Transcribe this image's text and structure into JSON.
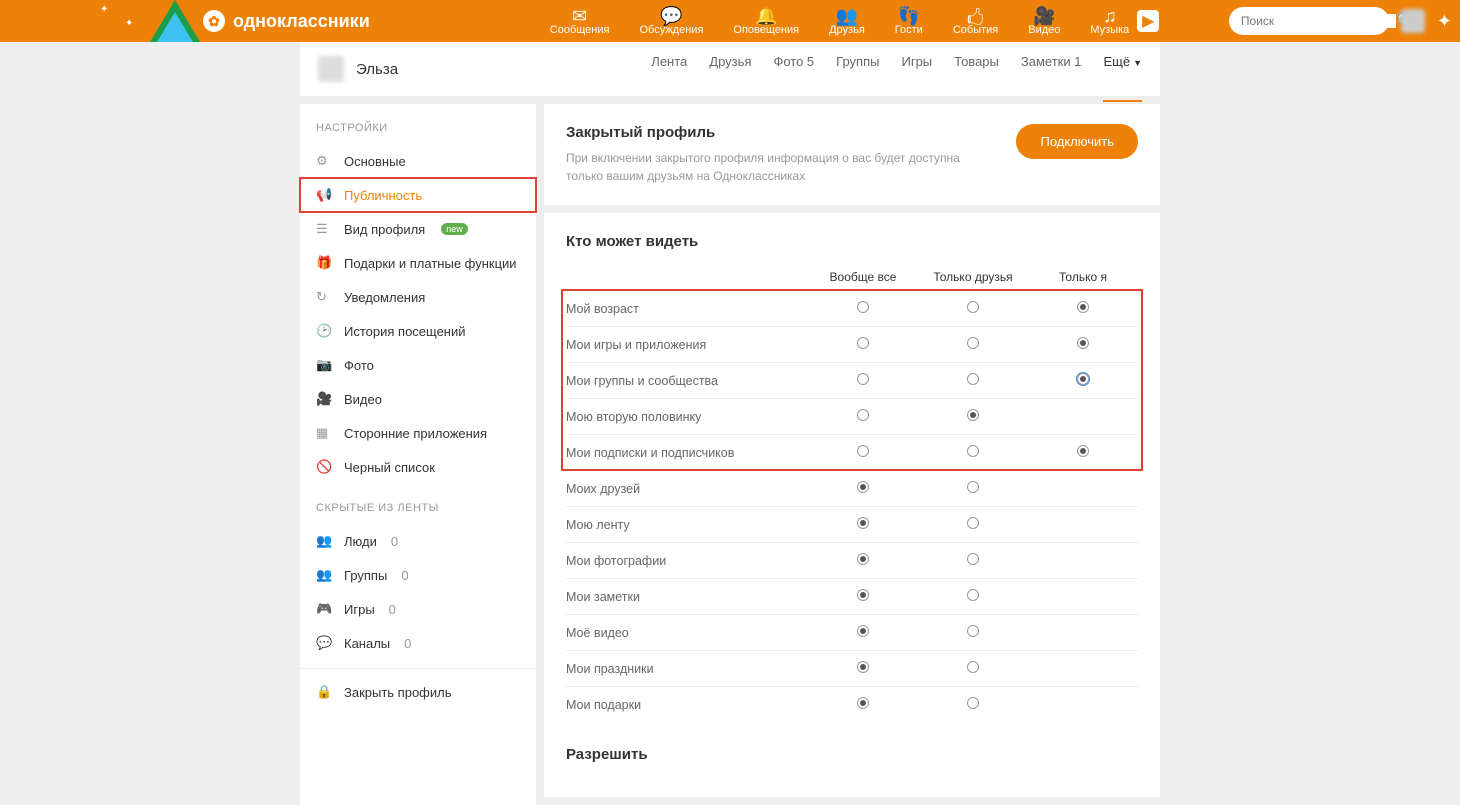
{
  "brand": "одноклассники",
  "topnav": [
    {
      "icon": "✉",
      "label": "Сообщения"
    },
    {
      "icon": "💬",
      "label": "Обсуждения"
    },
    {
      "icon": "🔔",
      "label": "Оповещения"
    },
    {
      "icon": "👥",
      "label": "Друзья"
    },
    {
      "icon": "👣",
      "label": "Гости"
    },
    {
      "icon": "🖒",
      "label": "События"
    },
    {
      "icon": "🎥",
      "label": "Видео"
    },
    {
      "icon": "♫",
      "label": "Музыка"
    }
  ],
  "search_placeholder": "Поиск",
  "profile_name": "Эльза",
  "tabs": [
    "Лента",
    "Друзья",
    "Фото 5",
    "Группы",
    "Игры",
    "Товары",
    "Заметки 1"
  ],
  "tab_more": "Ещё",
  "sidebar": {
    "title1": "НАСТРОЙКИ",
    "items": [
      {
        "icon": "⚙",
        "label": "Основные"
      },
      {
        "icon": "📢",
        "label": "Публичность",
        "active": true,
        "hl": true
      },
      {
        "icon": "☰",
        "label": "Вид профиля",
        "badge": "new"
      },
      {
        "icon": "🎁",
        "label": "Подарки и платные функции"
      },
      {
        "icon": "↻",
        "label": "Уведомления"
      },
      {
        "icon": "🕑",
        "label": "История посещений"
      },
      {
        "icon": "📷",
        "label": "Фото"
      },
      {
        "icon": "🎥",
        "label": "Видео"
      },
      {
        "icon": "▦",
        "label": "Сторонние приложения"
      },
      {
        "icon": "🚫",
        "label": "Черный список"
      }
    ],
    "title2": "СКРЫТЫЕ ИЗ ЛЕНТЫ",
    "hidden": [
      {
        "icon": "👥",
        "label": "Люди",
        "count": "0"
      },
      {
        "icon": "👥",
        "label": "Группы",
        "count": "0"
      },
      {
        "icon": "🎮",
        "label": "Игры",
        "count": "0"
      },
      {
        "icon": "💬",
        "label": "Каналы",
        "count": "0"
      }
    ],
    "close": {
      "icon": "🔒",
      "label": "Закрыть профиль"
    }
  },
  "closed_profile": {
    "title": "Закрытый профиль",
    "desc": "При включении закрытого профиля информация о вас будет доступна только вашим друзьям на Одноклассниках",
    "btn": "Подключить"
  },
  "privacy": {
    "title": "Кто может видеть",
    "cols": [
      "Вообще все",
      "Только друзья",
      "Только я"
    ],
    "rows_hl": [
      {
        "label": "Мой возраст",
        "sel": 2
      },
      {
        "label": "Мои игры и приложения",
        "sel": 2
      },
      {
        "label": "Мои группы и сообщества",
        "sel": 2,
        "focus": true
      },
      {
        "label": "Мою вторую половинку",
        "sel": 1,
        "two": true
      },
      {
        "label": "Мои подписки и подписчиков",
        "sel": 2
      }
    ],
    "rows": [
      {
        "label": "Моих друзей",
        "sel": 0,
        "two": true
      },
      {
        "label": "Мою ленту",
        "sel": 0,
        "two": true
      },
      {
        "label": "Мои фотографии",
        "sel": 0,
        "two": true
      },
      {
        "label": "Мои заметки",
        "sel": 0,
        "two": true
      },
      {
        "label": "Моё видео",
        "sel": 0,
        "two": true
      },
      {
        "label": "Мои праздники",
        "sel": 0,
        "two": true
      },
      {
        "label": "Мои подарки",
        "sel": 0,
        "two": true
      }
    ]
  },
  "allow_title": "Разрешить"
}
